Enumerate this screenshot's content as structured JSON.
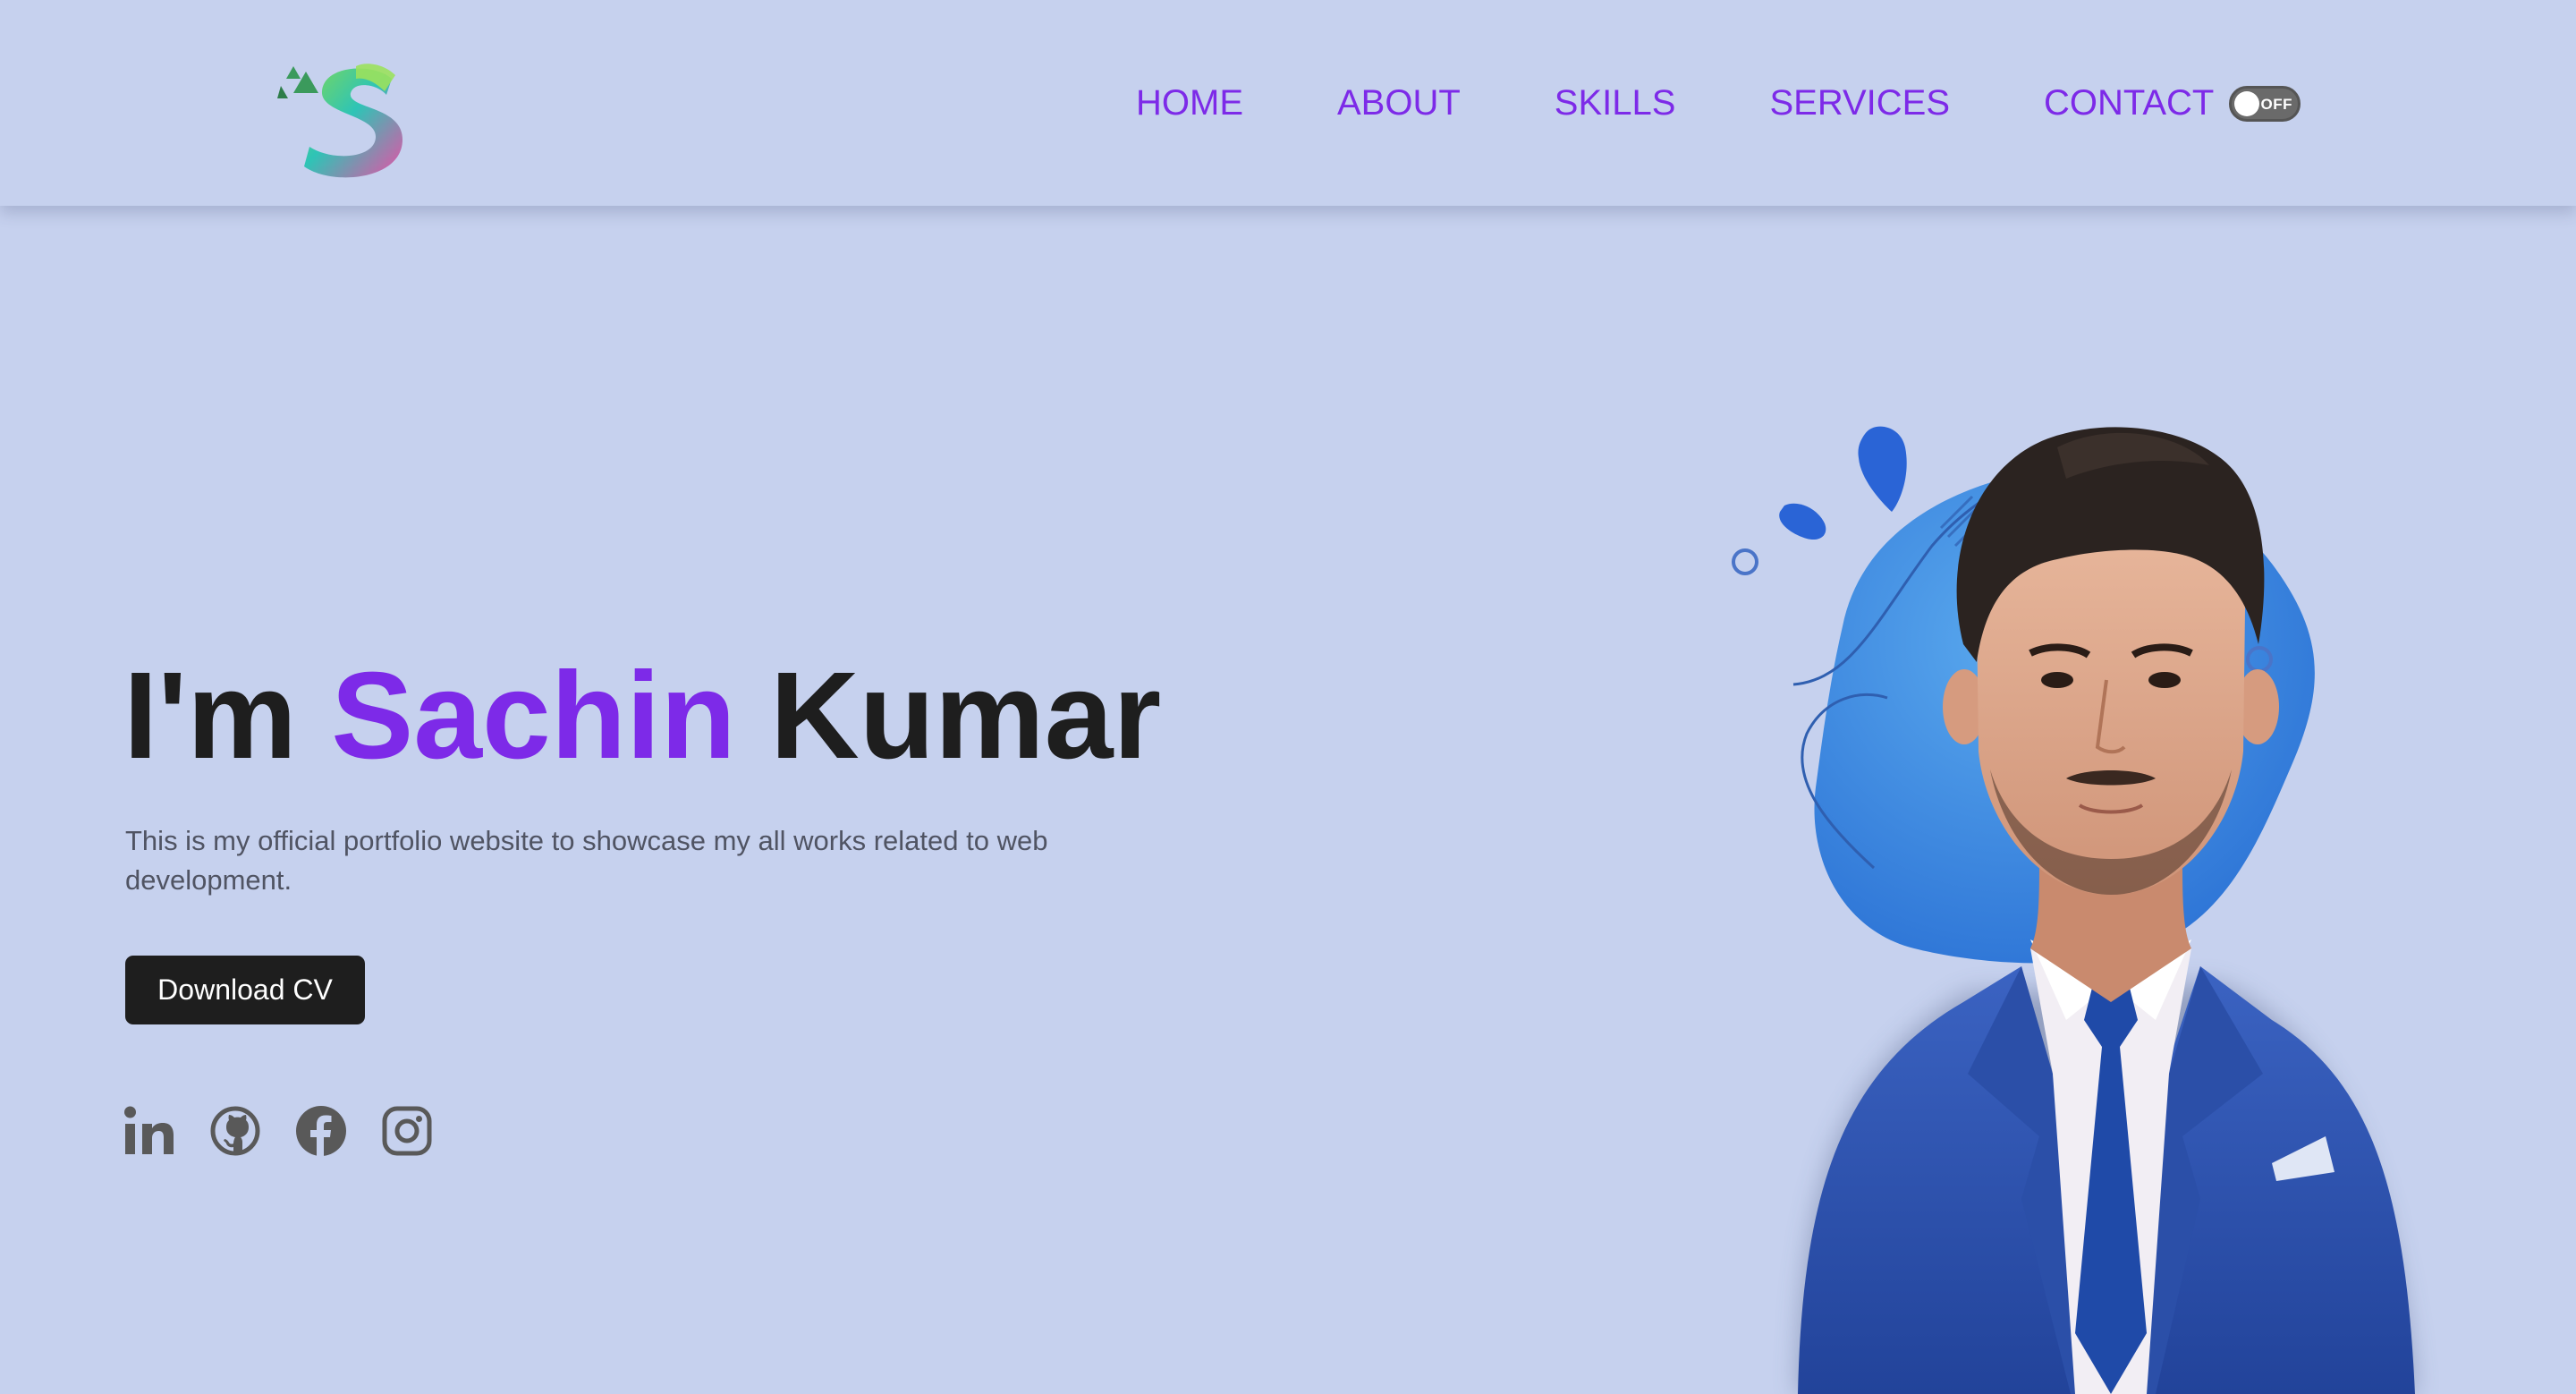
{
  "header": {
    "logo_icon": "stylized-s-logo-icon",
    "nav": [
      {
        "label": "HOME"
      },
      {
        "label": "ABOUT"
      },
      {
        "label": "SKILLS"
      },
      {
        "label": "SERVICES"
      },
      {
        "label": "CONTACT"
      }
    ],
    "theme_toggle": {
      "label": "OFF",
      "state": "off"
    }
  },
  "hero": {
    "greeting": "I'm",
    "first_name": "Sachin",
    "last_name": "Kumar",
    "description": "This is my official portfolio website to showcase my all works related to web development.",
    "cv_button": "Download CV"
  },
  "socials": [
    {
      "icon": "linkedin-icon"
    },
    {
      "icon": "github-icon"
    },
    {
      "icon": "facebook-icon"
    },
    {
      "icon": "instagram-icon"
    }
  ],
  "portrait": {
    "icon": "profile-portrait"
  },
  "colors": {
    "background": "#c6d1ee",
    "accent": "#7d2ae8",
    "text_dark": "#1e1e1e",
    "text_muted": "#505463",
    "blob_blue": "#2f6ee0",
    "suit_blue": "#2b4fa8"
  }
}
